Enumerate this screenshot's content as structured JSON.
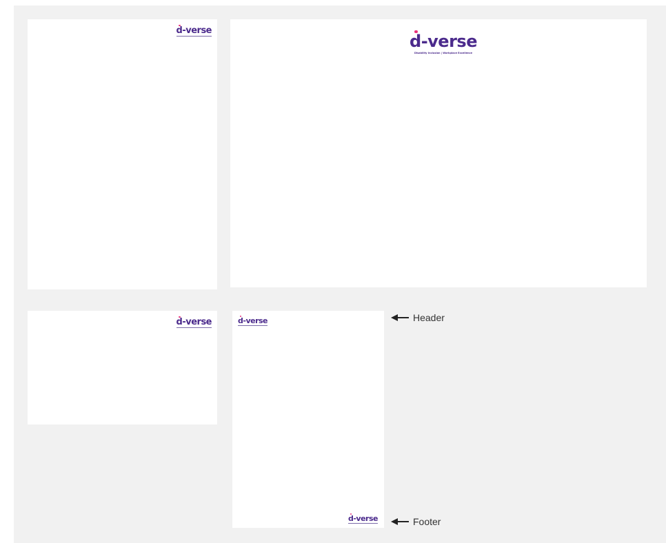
{
  "brand": {
    "logo_text": "d-verse",
    "logo_text_rest": "-verse",
    "logo_d": "d",
    "tagline": "Disability Inclusion | Workplace Excellence",
    "primary_color": "#4b2a8c",
    "dot_color": "#e8327a",
    "rule_color": "#7a6aa8"
  },
  "annotations": {
    "header_label": "Header",
    "footer_label": "Footer"
  }
}
